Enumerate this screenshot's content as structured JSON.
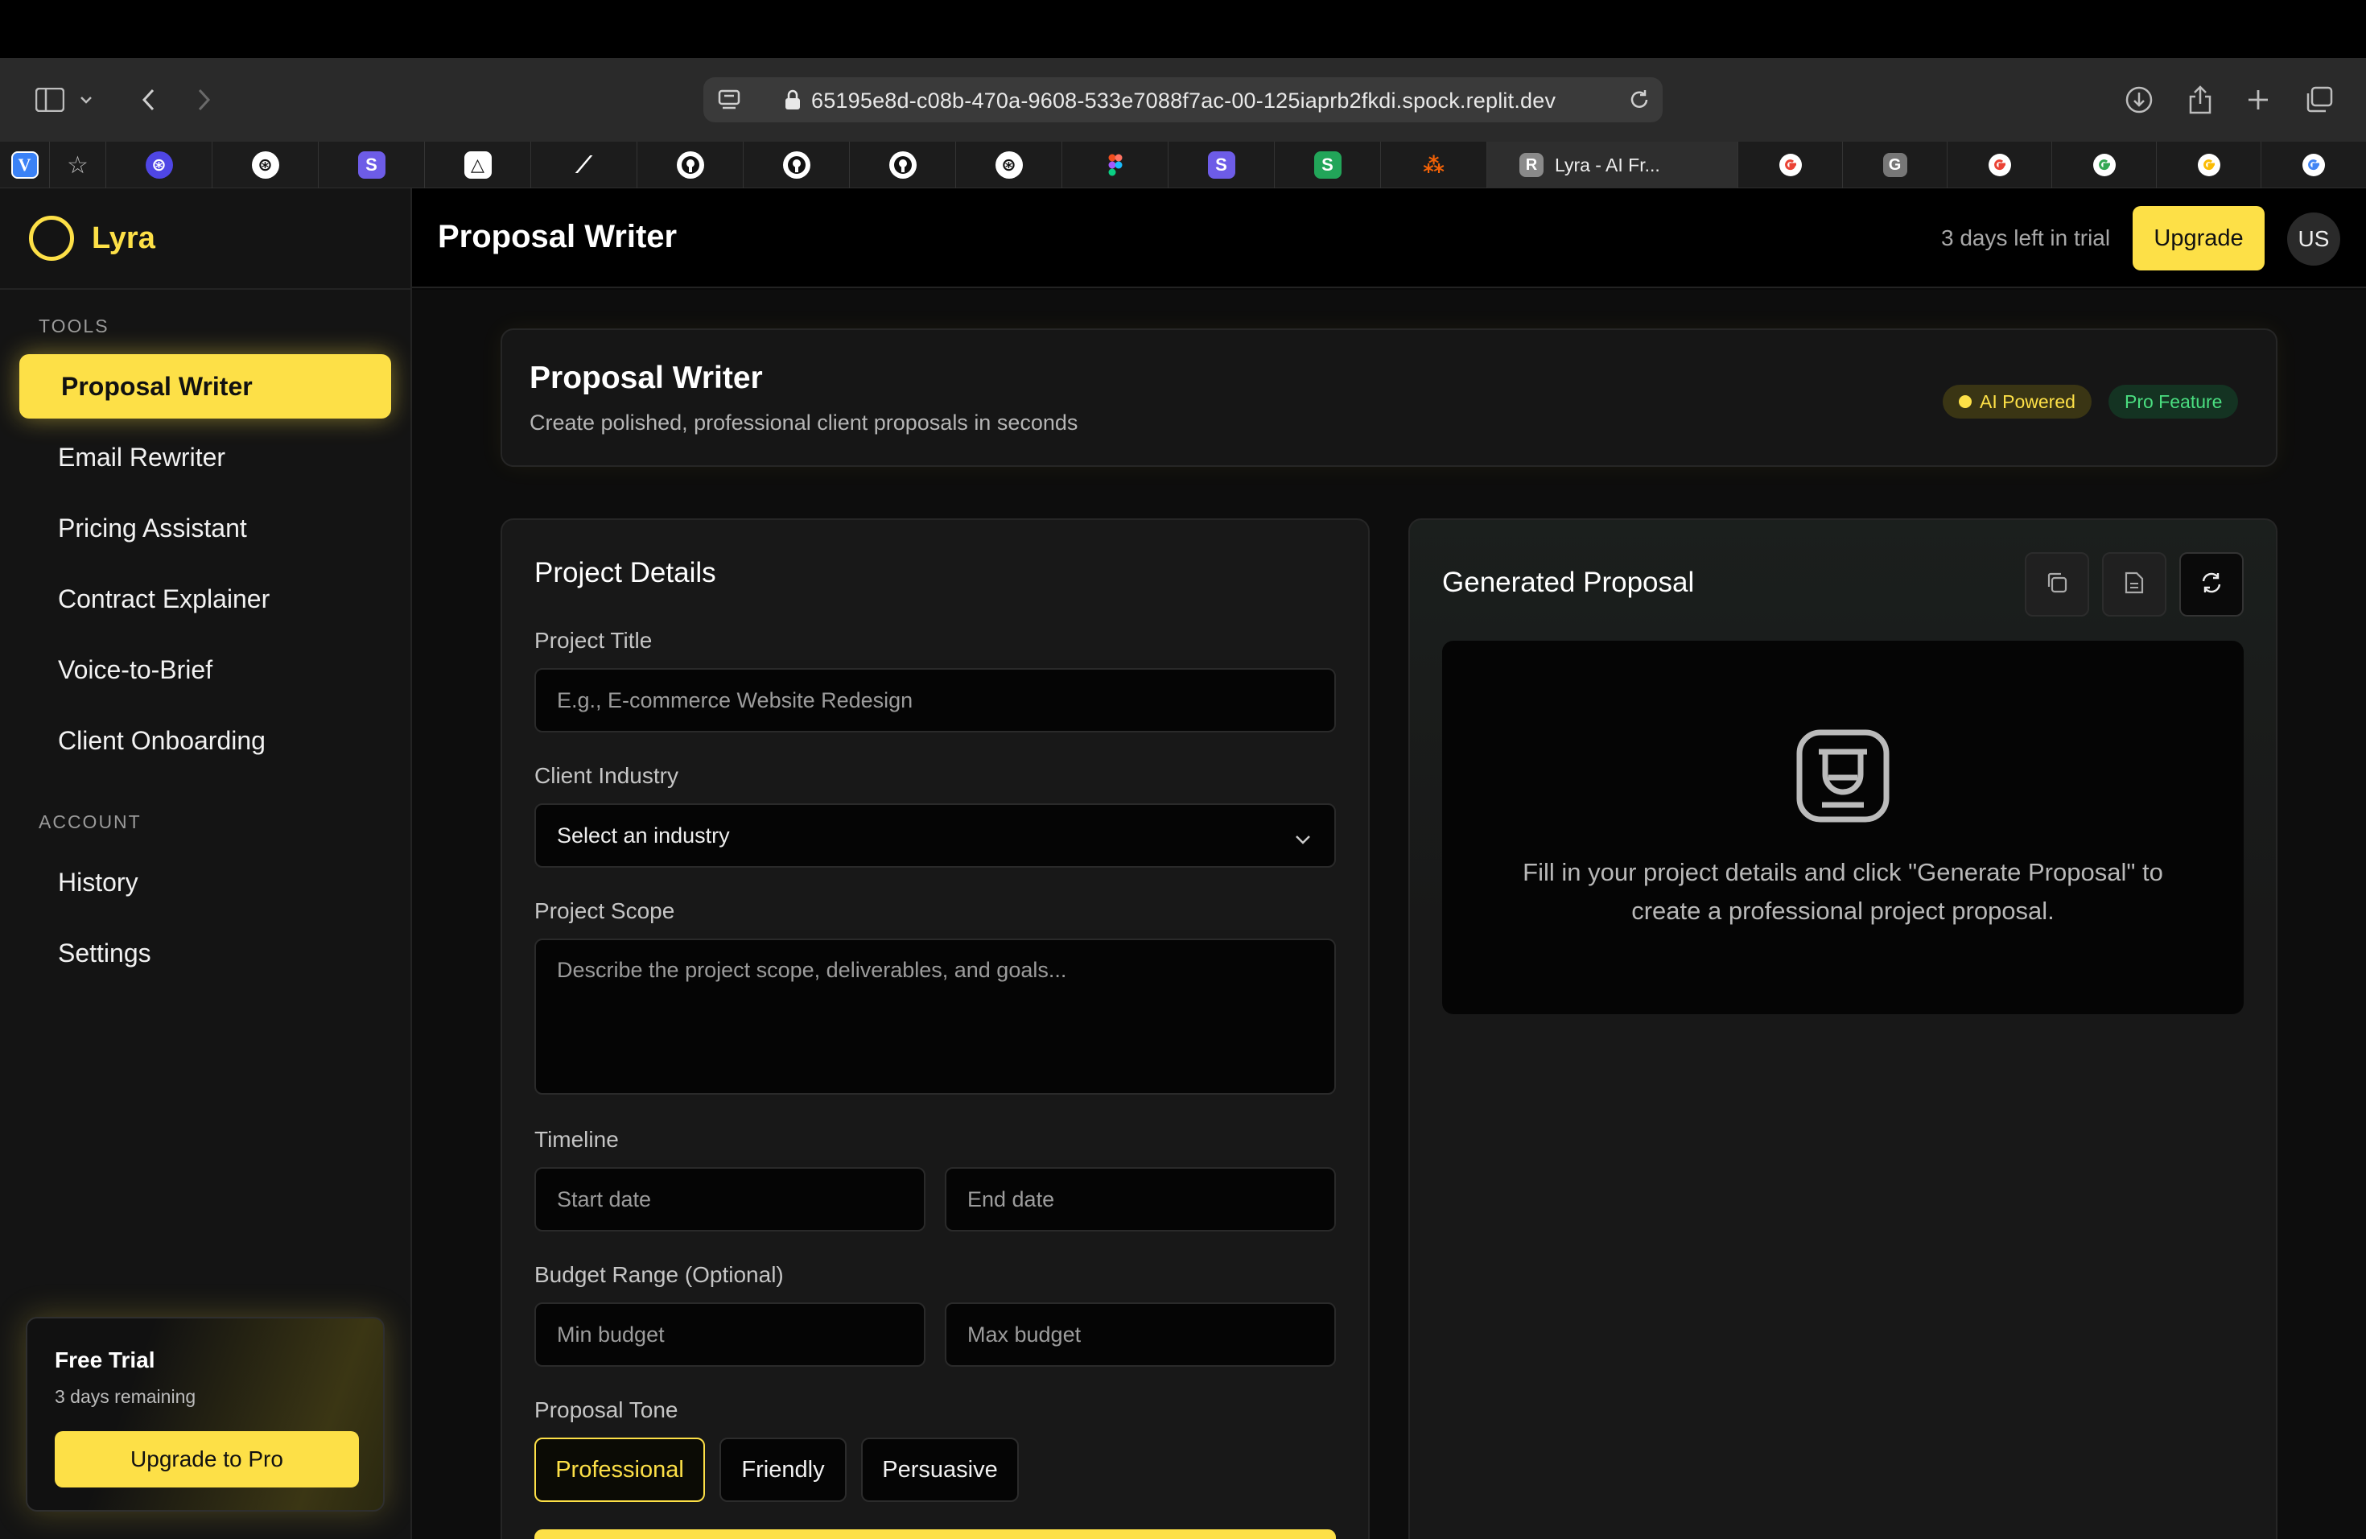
{
  "browser": {
    "url": "65195e8d-c08b-470a-9608-533e7088f7ac-00-125iaprb2fkdi.spock.replit.dev",
    "active_tab_title": "Lyra - AI Fr...",
    "active_tab_favicon": "R",
    "tab_favicons": [
      "V",
      "☆",
      "⊛",
      "⊛",
      "S",
      "△",
      "⟋",
      "github",
      "github",
      "github",
      "⊛",
      "figma",
      "S",
      "S",
      "⁂",
      "G",
      "G",
      "G",
      "G",
      "G",
      "G"
    ]
  },
  "app": {
    "brand": "Lyra",
    "header_title": "Proposal Writer",
    "trial_notice": "3 days left in trial",
    "upgrade_label": "Upgrade",
    "avatar_initials": "US"
  },
  "sidebar": {
    "tools_label": "TOOLS",
    "tools": [
      {
        "label": "Proposal Writer",
        "active": true
      },
      {
        "label": "Email Rewriter"
      },
      {
        "label": "Pricing Assistant"
      },
      {
        "label": "Contract Explainer"
      },
      {
        "label": "Voice-to-Brief"
      },
      {
        "label": "Client Onboarding"
      }
    ],
    "account_label": "ACCOUNT",
    "account": [
      {
        "label": "History"
      },
      {
        "label": "Settings"
      }
    ],
    "trial_card": {
      "title": "Free Trial",
      "subtitle": "3 days remaining",
      "button": "Upgrade to Pro"
    }
  },
  "hero": {
    "title": "Proposal Writer",
    "subtitle": "Create polished, professional client proposals in seconds",
    "badge_ai": "AI Powered",
    "badge_pro": "Pro Feature"
  },
  "form": {
    "title": "Project Details",
    "project_title_label": "Project Title",
    "project_title_placeholder": "E.g., E-commerce Website Redesign",
    "industry_label": "Client Industry",
    "industry_value": "Select an industry",
    "scope_label": "Project Scope",
    "scope_placeholder": "Describe the project scope, deliverables, and goals...",
    "timeline_label": "Timeline",
    "start_placeholder": "Start date",
    "end_placeholder": "End date",
    "budget_label": "Budget Range (Optional)",
    "min_placeholder": "Min budget",
    "max_placeholder": "Max budget",
    "tone_label": "Proposal Tone",
    "tones": [
      "Professional",
      "Friendly",
      "Persuasive"
    ],
    "selected_tone": "Professional"
  },
  "output": {
    "title": "Generated Proposal",
    "empty_message": "Fill in your project details and click \"Generate Proposal\" to create a professional project proposal."
  },
  "colors": {
    "accent": "#fde047",
    "pro_badge": "#4ade80"
  }
}
